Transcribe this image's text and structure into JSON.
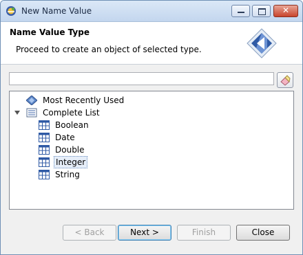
{
  "window": {
    "title": "New Name Value",
    "app_icon": "eclipse-icon",
    "controls": {
      "minimize": "minimize-icon",
      "maximize": "maximize-icon",
      "close": "close-icon"
    },
    "close_glyph": "✕"
  },
  "header": {
    "title": "Name Value Type",
    "description": "Proceed to create an object of selected type.",
    "banner_icon": "wizard-banner-icon"
  },
  "filter": {
    "value": "",
    "placeholder": "",
    "clear_icon": "eraser-icon"
  },
  "tree": {
    "items": [
      {
        "label": "Most Recently Used",
        "icon": "recent-diamond-icon",
        "level": 0,
        "expandable": false
      },
      {
        "label": "Complete List",
        "icon": "list-icon",
        "level": 0,
        "expandable": true,
        "expanded": true
      },
      {
        "label": "Boolean",
        "icon": "table-icon",
        "level": 1
      },
      {
        "label": "Date",
        "icon": "table-icon",
        "level": 1
      },
      {
        "label": "Double",
        "icon": "table-icon",
        "level": 1
      },
      {
        "label": "Integer",
        "icon": "table-icon",
        "level": 1,
        "selected": true
      },
      {
        "label": "String",
        "icon": "table-icon",
        "level": 1
      }
    ]
  },
  "buttons": {
    "back": "< Back",
    "next": "Next >",
    "finish": "Finish",
    "close": "Close"
  },
  "colors": {
    "accent": "#3c7fb1",
    "selection": "#e6eef9"
  }
}
